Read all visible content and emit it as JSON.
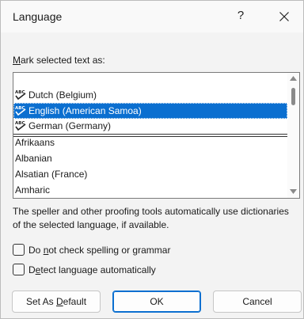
{
  "dialog": {
    "title": "Language",
    "help_label": "?",
    "close_icon": "close-icon"
  },
  "mark_label": {
    "pre": "",
    "underline": "M",
    "post": "ark selected text as:"
  },
  "languages": {
    "proofing": [
      {
        "label": "Dutch (Belgium)",
        "icon": "spellcheck-icon",
        "selected": false
      },
      {
        "label": "English (American Samoa)",
        "icon": "spellcheck-icon",
        "selected": true
      },
      {
        "label": "German (Germany)",
        "icon": "spellcheck-icon",
        "selected": false
      }
    ],
    "other": [
      {
        "label": "Afrikaans"
      },
      {
        "label": "Albanian"
      },
      {
        "label": "Alsatian (France)"
      },
      {
        "label": "Amharic"
      }
    ],
    "selection_color": "#0b6fd0"
  },
  "description": "The speller and other proofing tools automatically use dictionaries of the selected language, if available.",
  "options": {
    "no_proof": {
      "pre": "Do ",
      "underline": "n",
      "post": "ot check spelling or grammar",
      "checked": false
    },
    "detect": {
      "pre": "D",
      "underline": "e",
      "post": "tect language automatically",
      "checked": false
    }
  },
  "buttons": {
    "default": {
      "pre": "Set As ",
      "underline": "D",
      "post": "efault"
    },
    "ok": "OK",
    "cancel": "Cancel"
  }
}
